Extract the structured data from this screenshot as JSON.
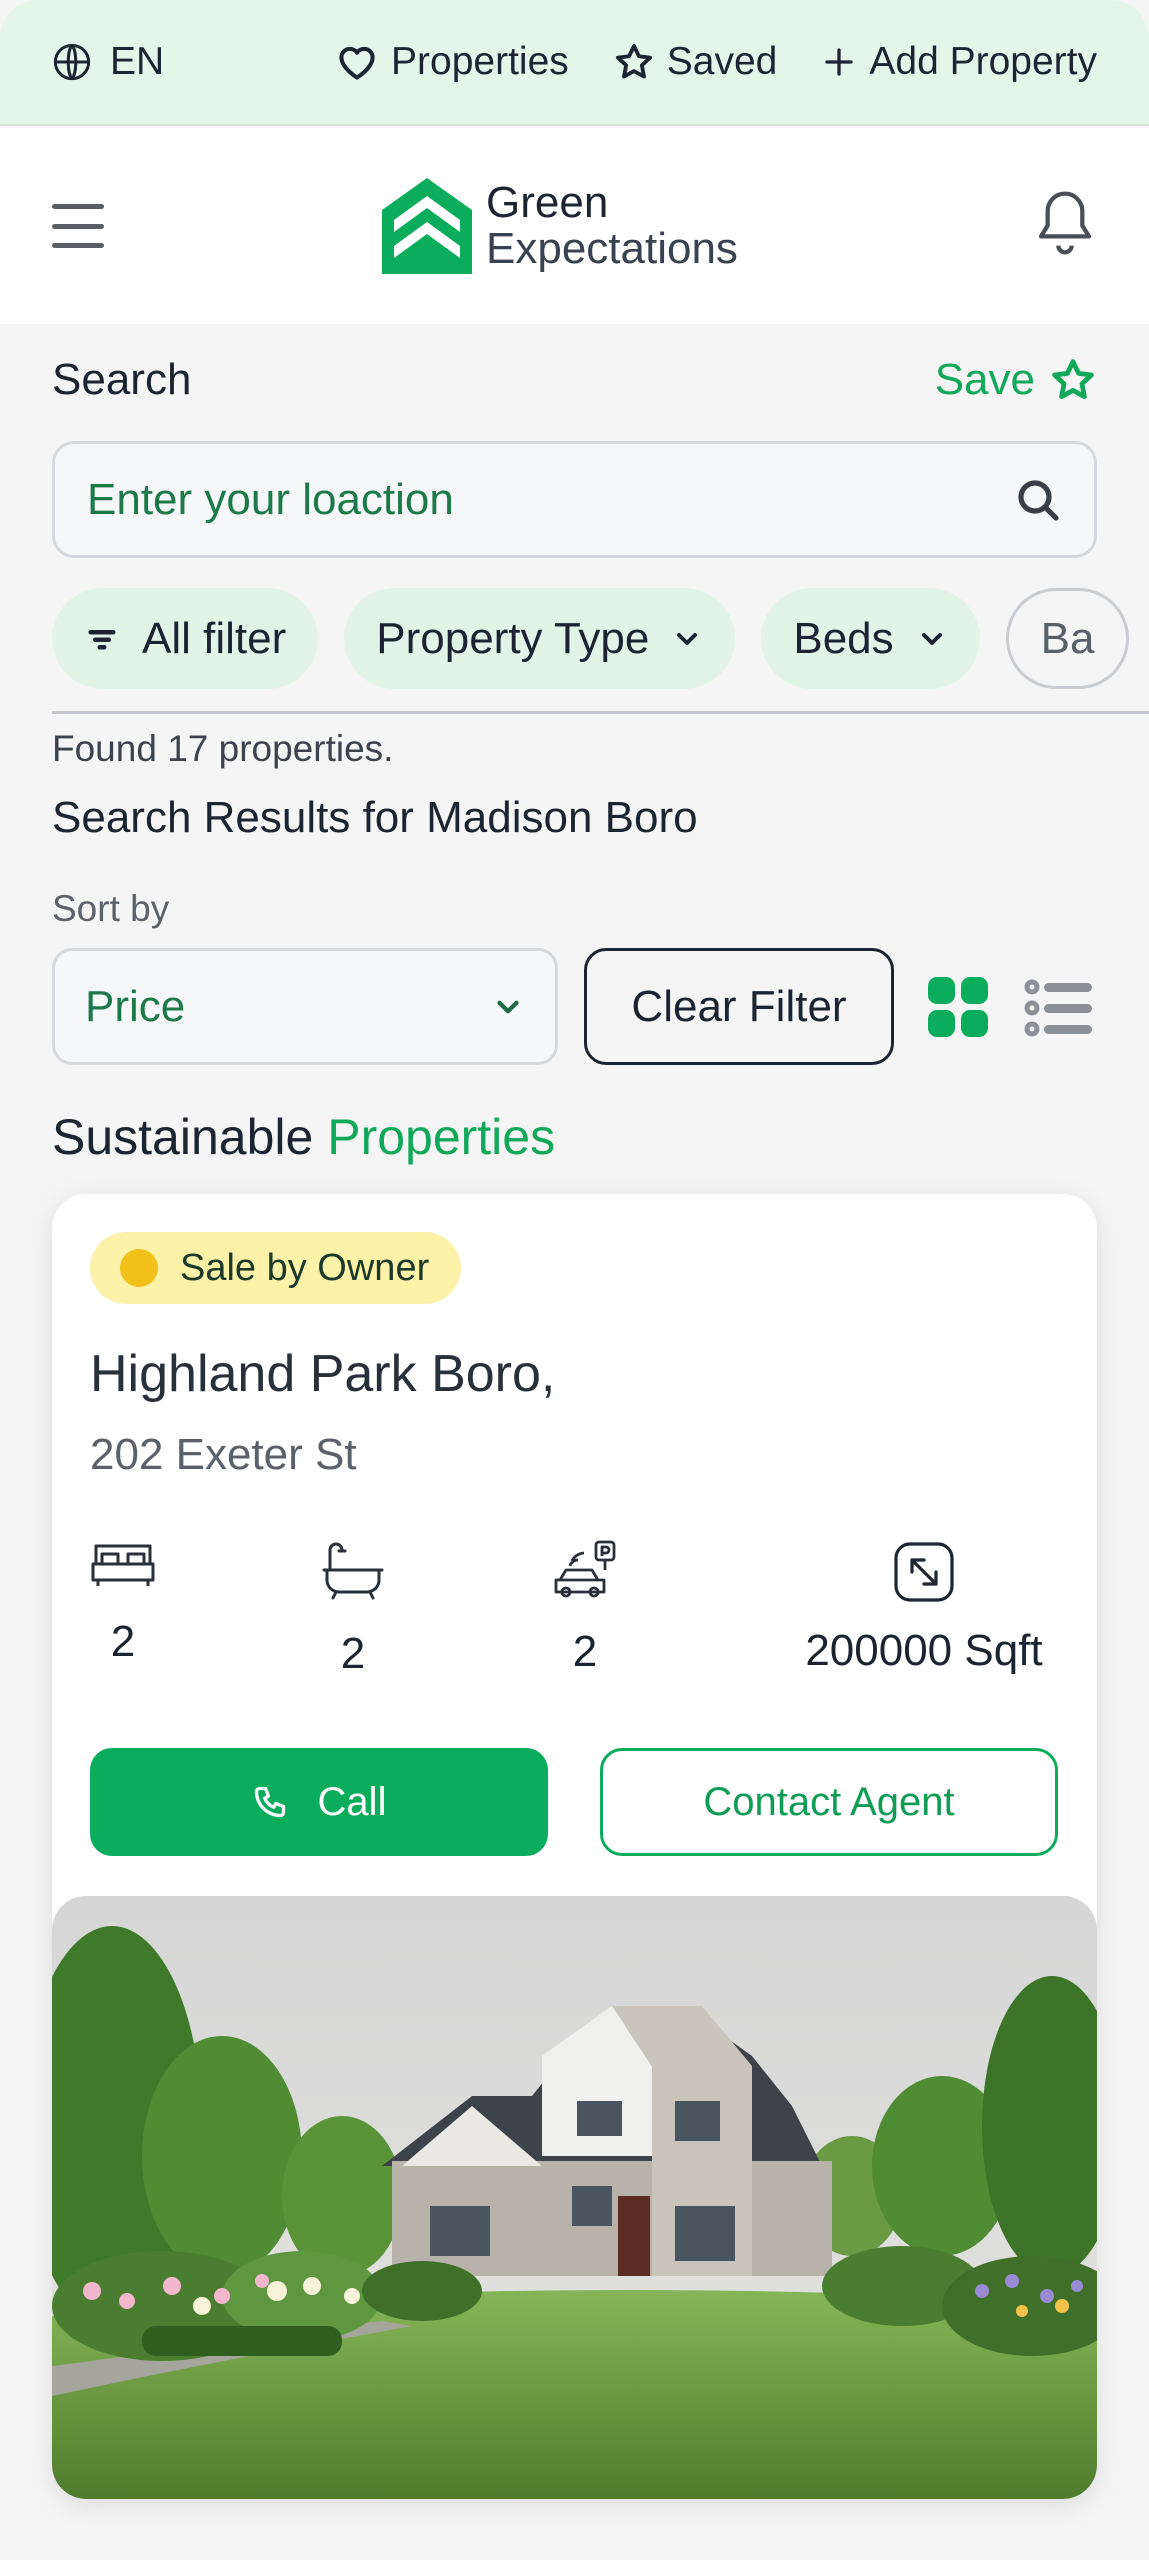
{
  "topbar": {
    "language": "EN",
    "links": [
      {
        "label": "Properties",
        "icon": "heart-icon"
      },
      {
        "label": "Saved",
        "icon": "star-icon"
      },
      {
        "label": "Add Property",
        "icon": "plus-icon"
      }
    ]
  },
  "header": {
    "logo_line1": "Green",
    "logo_line2": "Expectations"
  },
  "search": {
    "title": "Search",
    "save_label": "Save",
    "placeholder": "Enter your loaction"
  },
  "filters": [
    {
      "label": "All filter"
    },
    {
      "label": "Property Type"
    },
    {
      "label": "Beds"
    },
    {
      "label": "Ba"
    }
  ],
  "results": {
    "found_text": "Found 17 properties.",
    "title": "Search Results for Madison Boro",
    "sort_label": "Sort by",
    "sort_value": "Price",
    "clear_label": "Clear Filter"
  },
  "section": {
    "title_plain": "Sustainable",
    "title_accent": "Properties"
  },
  "card": {
    "badge": "Sale by Owner",
    "title": "Highland Park Boro,",
    "address": "202 Exeter St",
    "beds": "2",
    "baths": "2",
    "parking": "2",
    "area": "200000 Sqft",
    "call_label": "Call",
    "agent_label": "Contact Agent"
  },
  "colors": {
    "brand_green": "#0bad5c",
    "topbar_bg": "#e4f6ea",
    "chip_bg": "#e2f4e8",
    "badge_bg": "#fdf2a8",
    "badge_dot": "#f2c018"
  }
}
